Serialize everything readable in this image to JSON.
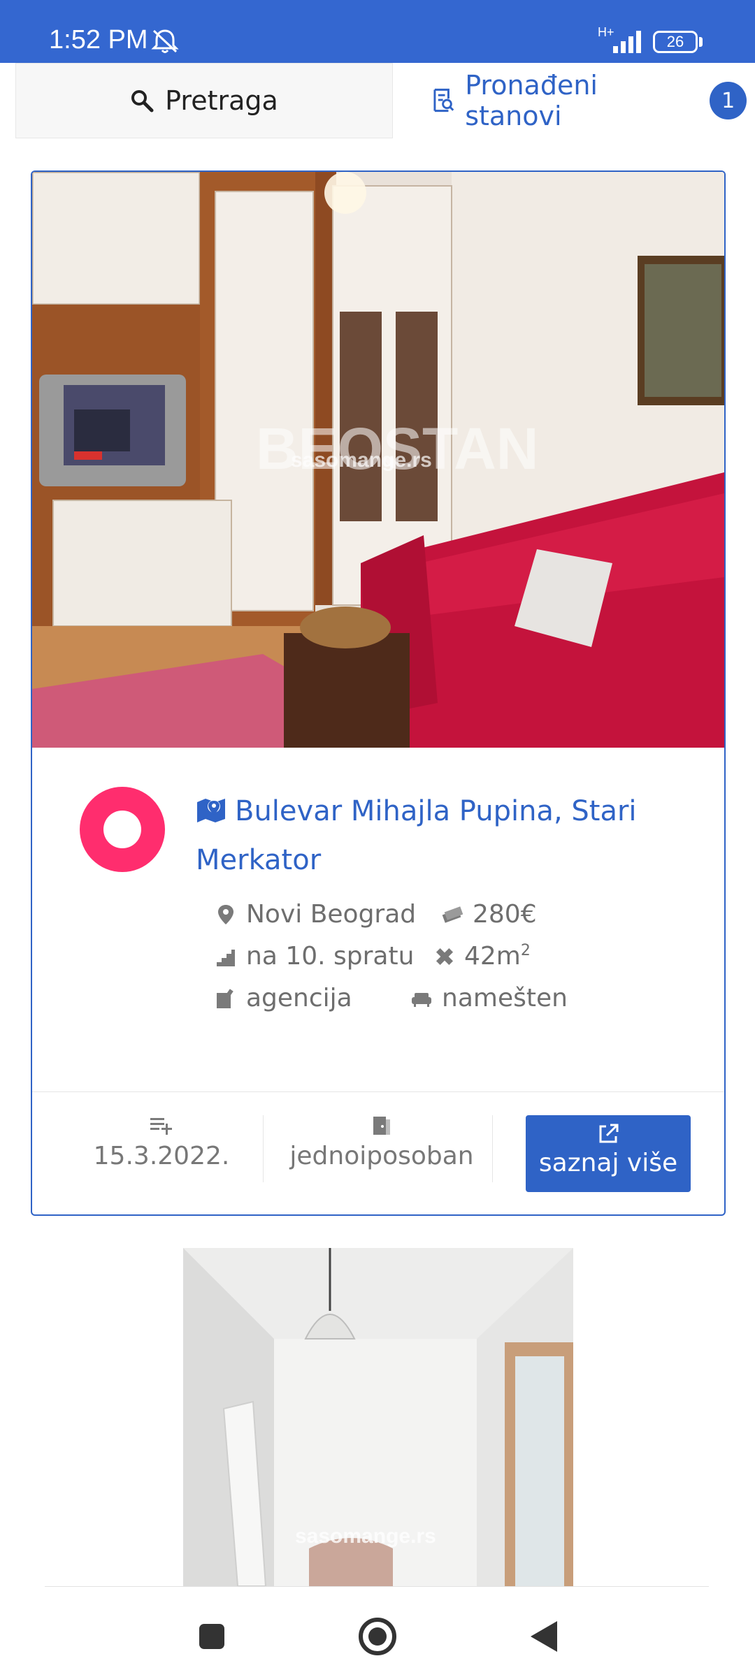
{
  "status_bar": {
    "time": "1:52 PM",
    "network": "H+",
    "battery": "26"
  },
  "tabs": {
    "search_label": "Pretraga",
    "found_label": "Pronađeni stanovi",
    "found_count": "1"
  },
  "listing": {
    "photo_watermark_brand": "BEOSTAN",
    "photo_watermark_site": "sasomange.rs",
    "address": "Bulevar Mihajla Pupina, Stari Merkator",
    "location": "Novi Beograd",
    "price": "280€",
    "floor": "na 10. spratu",
    "area": "42m",
    "area_sup": "2",
    "advertiser": "agencija",
    "furnishing": "namešten",
    "date": "15.3.2022.",
    "rooms": "jednoiposoban",
    "more_button": "saznaj više"
  },
  "listing2": {
    "photo_watermark_site": "sasomange.rs"
  },
  "colors": {
    "accent": "#2f63c6",
    "status_bar": "#3467d0",
    "logo": "#ff2d6e"
  }
}
